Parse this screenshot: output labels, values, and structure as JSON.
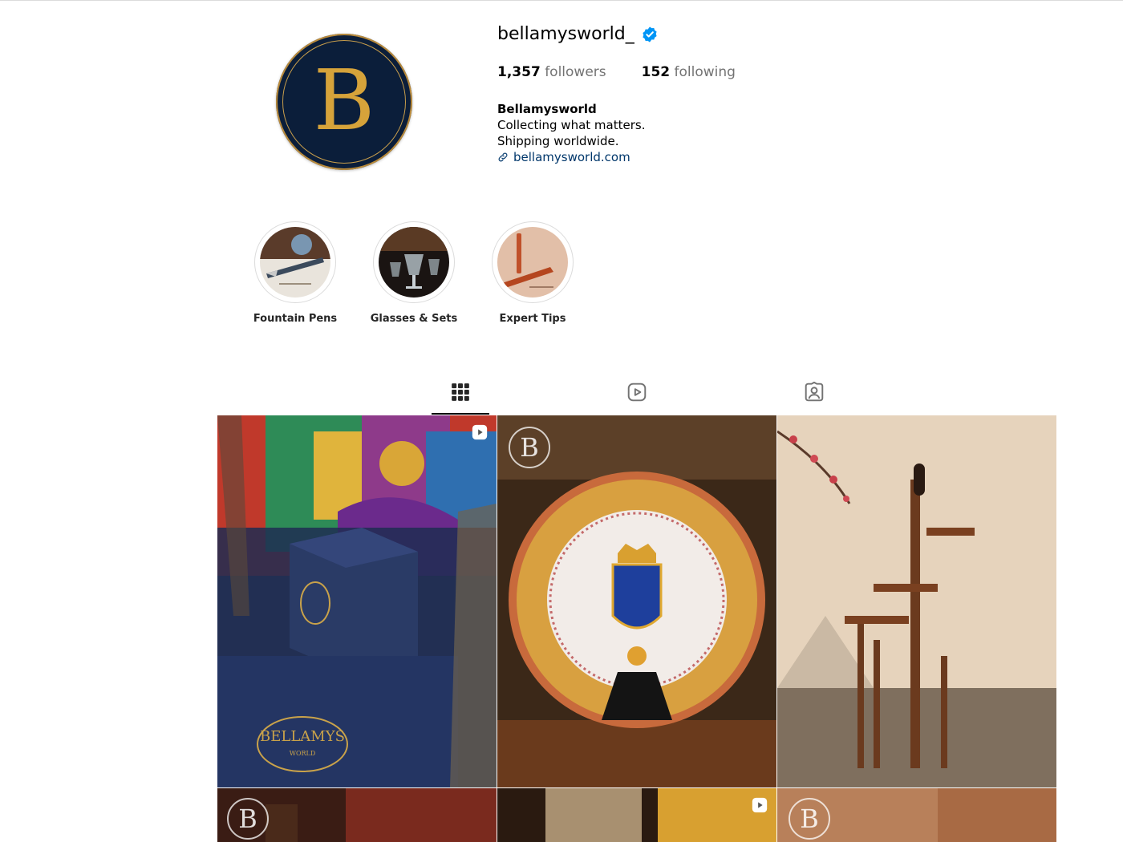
{
  "profile": {
    "username": "bellamysworld_",
    "avatar_letter": "B",
    "followers_count": "1,357",
    "followers_label": "followers",
    "following_count": "152",
    "following_label": "following",
    "bio_name": "Bellamysworld",
    "bio_line1": "Collecting what matters.",
    "bio_line2": "Shipping worldwide.",
    "website": "bellamysworld.com"
  },
  "highlights": [
    {
      "label": "Fountain Pens"
    },
    {
      "label": "Glasses & Sets"
    },
    {
      "label": "Expert Tips"
    }
  ],
  "tabs": [
    {
      "icon": "grid-icon",
      "active": true
    },
    {
      "icon": "reels-icon",
      "active": false
    },
    {
      "icon": "tagged-icon",
      "active": false
    }
  ],
  "posts": [
    {
      "type": "reel",
      "box_text": "BELLAMYS",
      "box_subtext": "WORLD"
    },
    {
      "type": "image",
      "watermark": "B"
    },
    {
      "type": "image"
    },
    {
      "type": "image",
      "watermark": "B"
    },
    {
      "type": "reel"
    },
    {
      "type": "image",
      "watermark": "B"
    }
  ],
  "colors": {
    "brand_navy": "#0b1e3a",
    "brand_gold": "#d6a33a",
    "verified_blue": "#0095f6",
    "link_blue": "#00376b",
    "secondary_text": "#737373"
  }
}
